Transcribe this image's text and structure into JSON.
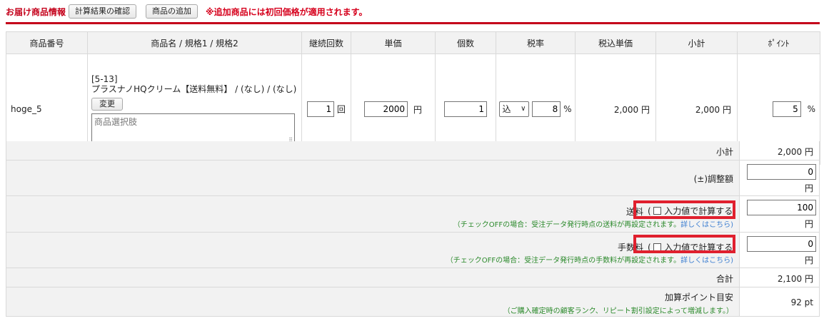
{
  "header": {
    "title": "お届け商品情報",
    "confirm_button": "計算結果の確認",
    "add_button": "商品の追加",
    "notice": "※追加商品には初回価格が適用されます。"
  },
  "table": {
    "headers": [
      "商品番号",
      "商品名 / 規格1 / 規格2",
      "継続回数",
      "単価",
      "個数",
      "税率",
      "税込単価",
      "小計",
      "ﾎﾟｲﾝﾄ"
    ],
    "row": {
      "code": "hoge_5",
      "product_code": "[5-13]",
      "product_name": "プラスナノHQクリーム【送料無料】 / (なし) / (なし)",
      "change_button": "変更",
      "option_placeholder": "商品選択肢",
      "continuation": "1",
      "continuation_unit": "回",
      "unit_price": "2000",
      "yen": "円",
      "quantity": "1",
      "tax_type": "込",
      "tax_rate": "8",
      "percent": "%",
      "tax_incl_price": "2,000 円",
      "subtotal": "2,000 円",
      "point": "5"
    }
  },
  "summary": {
    "subtotal_label": "小計",
    "subtotal_value": "2,000 円",
    "adjust_label": "(±)調整額",
    "adjust_value": "0",
    "shipping_label": "送料",
    "shipping_checkbox": "入力値で計算する",
    "shipping_note": "（チェックOFFの場合：受注データ発行時点の送料が再設定されます。",
    "details_link": "詳しくはこちら)",
    "shipping_value": "100",
    "fee_label": "手数料",
    "fee_checkbox": "入力値で計算する",
    "fee_note": "（チェックOFFの場合：受注データ発行時点の手数料が再設定されます。",
    "fee_value": "0",
    "total_label": "合計",
    "total_value": "2,100 円",
    "points_label": "加算ポイント目安",
    "points_note": "（ご購入確定時の顧客ランク、リピート割引設定によって増減します。）",
    "points_value": "92 pt",
    "yen": "円"
  },
  "colors": {
    "accent_red": "#c4001a",
    "note_green": "#2c8a2c",
    "link_blue": "#3d7fd1",
    "highlight_red": "#e0202e"
  }
}
